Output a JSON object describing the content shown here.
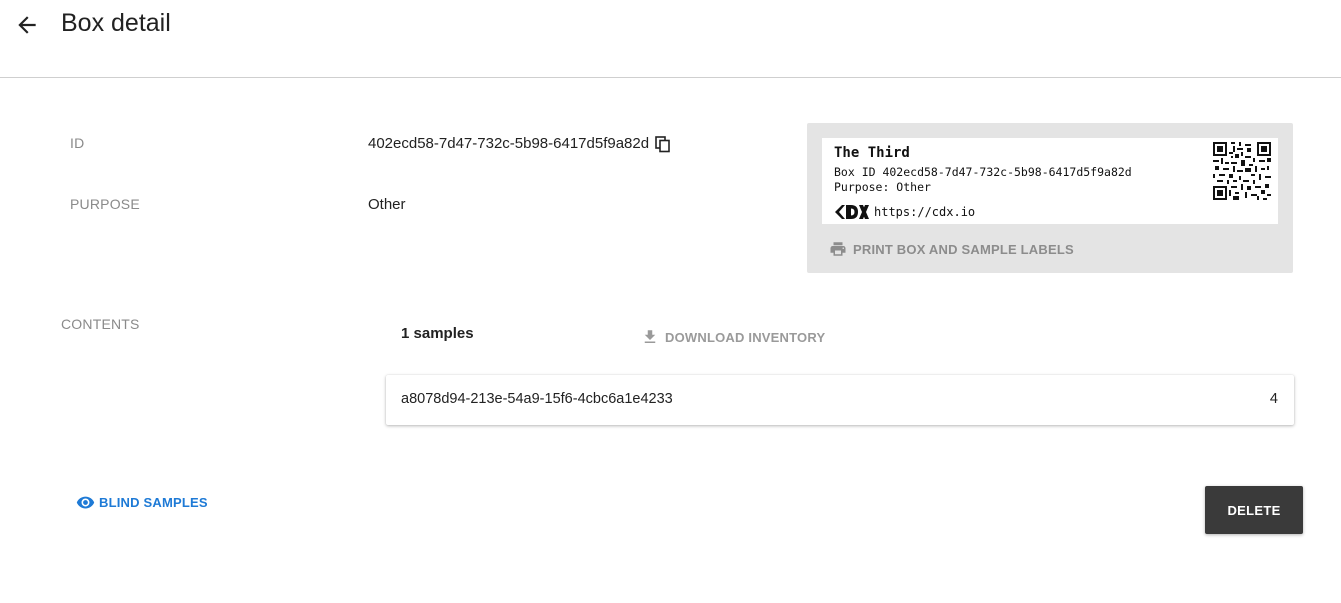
{
  "header": {
    "title": "Box detail",
    "back_icon": "arrow-left-icon"
  },
  "fields": {
    "id_label": "ID",
    "id_value": "402ecd58-7d47-732c-5b98-6417d5f9a82d",
    "purpose_label": "PURPOSE",
    "purpose_value": "Other",
    "contents_label": "CONTENTS"
  },
  "label_preview": {
    "name": "The Third",
    "box_id_line": "Box ID 402ecd58-7d47-732c-5b98-6417d5f9a82d",
    "purpose_line": "Purpose: Other",
    "url": "https://cdx.io",
    "print_label": "PRINT BOX AND SAMPLE LABELS",
    "print_icon": "printer-icon"
  },
  "contents": {
    "count_label": "1 samples",
    "download_label": "DOWNLOAD INVENTORY",
    "download_icon": "download-icon",
    "samples": [
      {
        "id": "a8078d94-213e-54a9-15f6-4cbc6a1e4233",
        "position": "4"
      }
    ]
  },
  "actions": {
    "blind_label": "BLIND SAMPLES",
    "blind_icon": "eye-icon",
    "delete_label": "DELETE"
  },
  "colors": {
    "accent_blue": "#1e7ad6",
    "delete_bg": "#3a3a3a",
    "panel_bg": "#e4e4e4"
  }
}
